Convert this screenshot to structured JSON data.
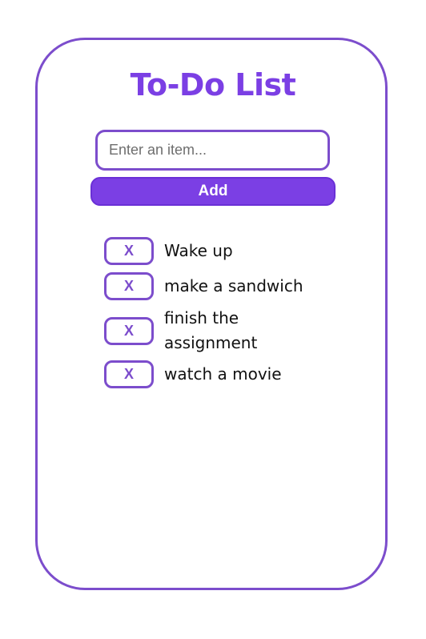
{
  "app": {
    "title": "To-Do List"
  },
  "input": {
    "placeholder": "Enter an item...",
    "value": ""
  },
  "add_button": {
    "label": "Add"
  },
  "todo_items": [
    {
      "text": "Wake up",
      "remove_label": "X"
    },
    {
      "text": "make a sandwich",
      "remove_label": "X"
    },
    {
      "text": "finish the assignment",
      "remove_label": "X"
    },
    {
      "text": "watch a movie",
      "remove_label": "X"
    }
  ],
  "colors": {
    "accent": "#7b3fe4",
    "border": "#7c4dcc",
    "text": "#111111",
    "background": "#ffffff"
  }
}
